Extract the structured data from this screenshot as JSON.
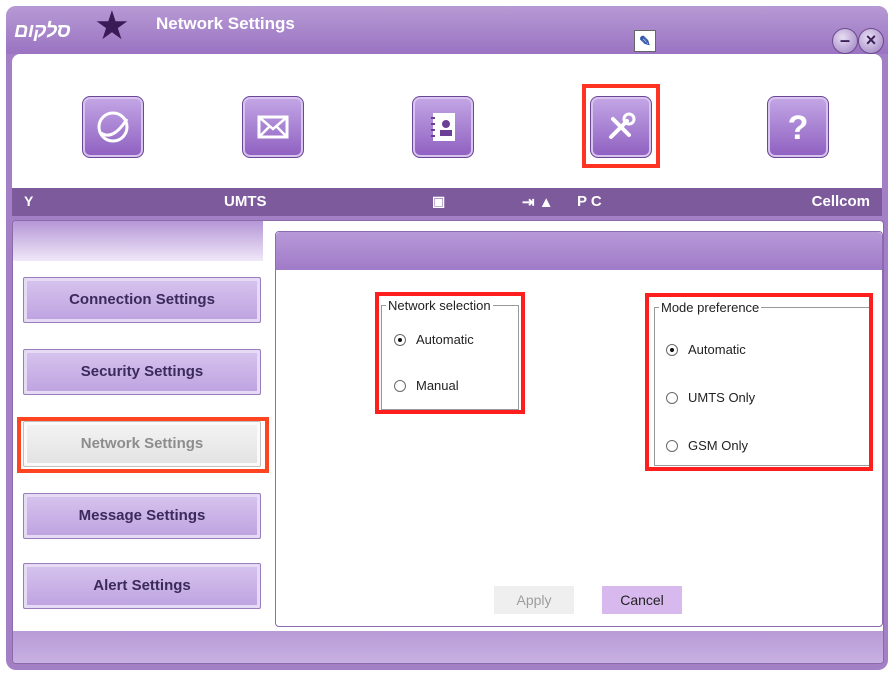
{
  "titlebar": {
    "logo_text": "סלקום",
    "title": "Network Settings"
  },
  "toolbar": {
    "tools": [
      {
        "icon": "internet-icon"
      },
      {
        "icon": "mail-icon"
      },
      {
        "icon": "contacts-icon"
      },
      {
        "icon": "settings-icon"
      },
      {
        "icon": "help-icon"
      }
    ],
    "help_glyph": "?"
  },
  "status": {
    "network_type": "UMTS",
    "pc_label": "P C",
    "operator": "Cellcom"
  },
  "sidebar": {
    "items": [
      {
        "label": "Connection Settings"
      },
      {
        "label": "Security Settings"
      },
      {
        "label": "Network Settings",
        "active": true
      },
      {
        "label": "Message Settings"
      },
      {
        "label": "Alert Settings"
      }
    ]
  },
  "network_selection": {
    "legend": "Network selection",
    "options": [
      "Automatic",
      "Manual"
    ],
    "selected": "Automatic"
  },
  "mode_preference": {
    "legend": "Mode preference",
    "options": [
      "Automatic",
      "UMTS Only",
      "GSM Only"
    ],
    "selected": "Automatic"
  },
  "buttons": {
    "apply": "Apply",
    "cancel": "Cancel"
  },
  "colors": {
    "accent": "#a37fc6",
    "highlight": "#ff1e1e"
  }
}
